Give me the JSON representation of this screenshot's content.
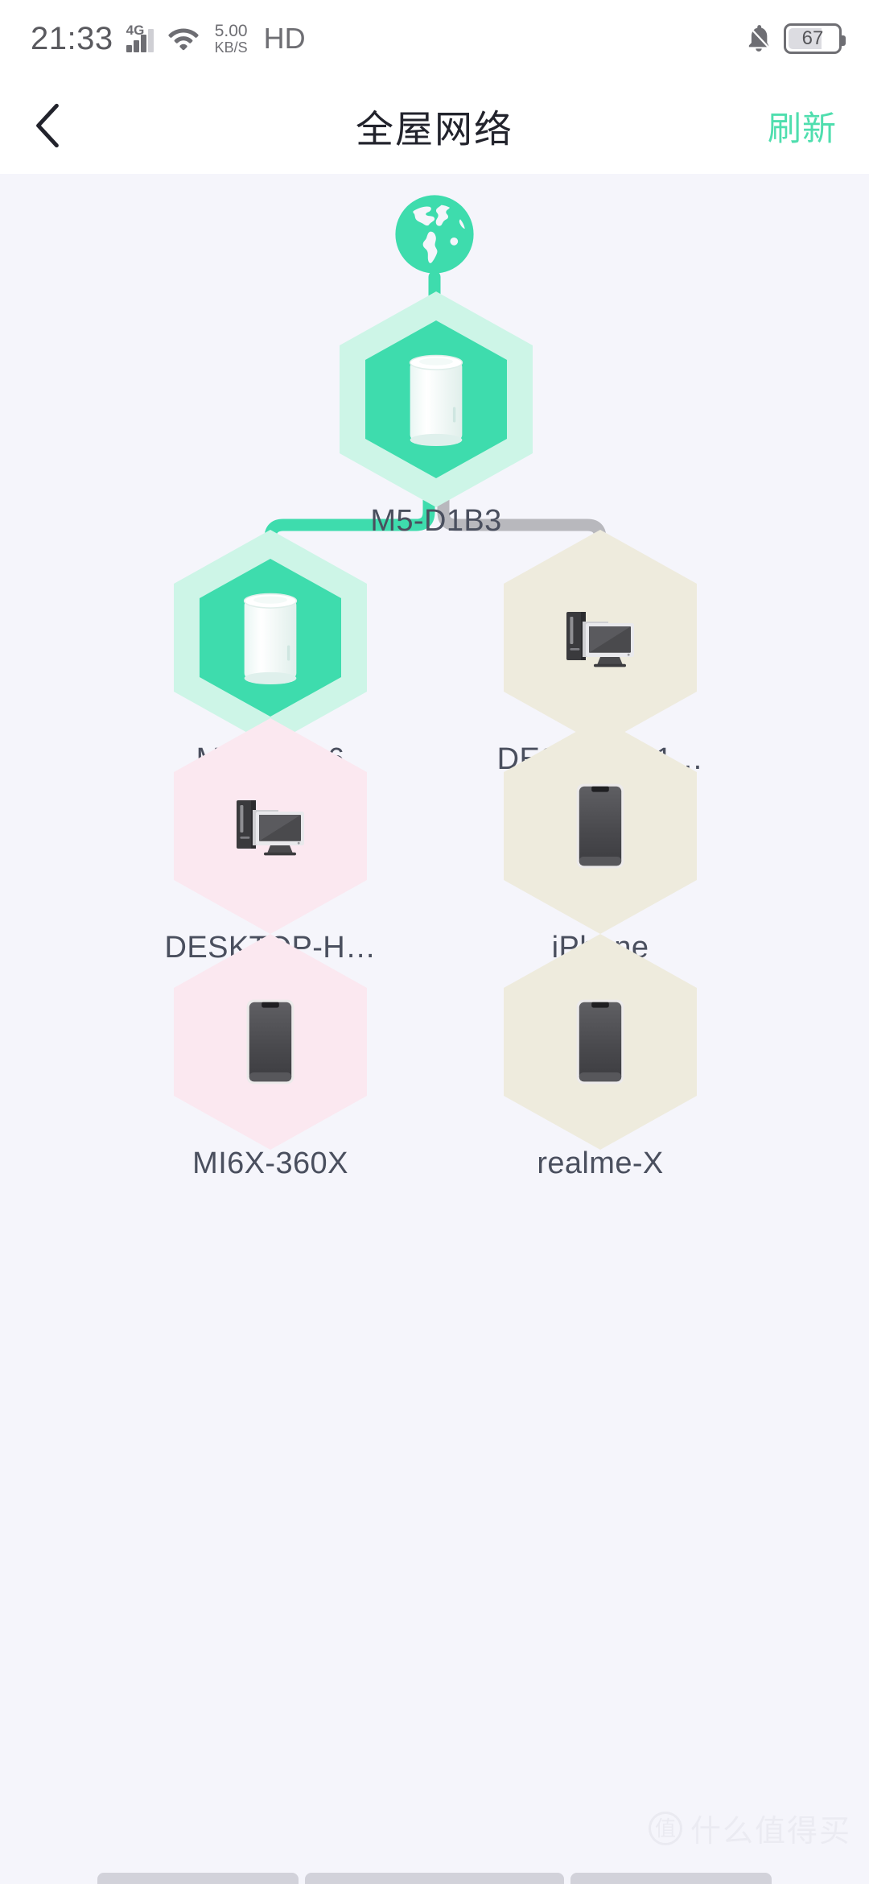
{
  "status_bar": {
    "time": "21:33",
    "network_type": "4G",
    "wifi_icon": "wifi-icon",
    "speed_value": "5.00",
    "speed_unit": "KB/S",
    "hd_label": "HD",
    "mute_icon": "bell-muted-icon",
    "battery_level": "67"
  },
  "header": {
    "back_icon": "chevron-left-icon",
    "title": "全屋网络",
    "refresh_label": "刷新"
  },
  "topology": {
    "internet": {
      "icon": "globe-icon",
      "label": ""
    },
    "nodes": [
      {
        "id": "m5-d1b3",
        "label": "M5-D1B3",
        "icon": "router-icon",
        "type": "router",
        "halo_color": "#cdf5e7",
        "core_color": "#3edcad"
      },
      {
        "id": "m50-d1b6",
        "label": "M50-D1B6",
        "icon": "router-icon",
        "type": "router",
        "halo_color": "#cdf5e7",
        "core_color": "#3edcad"
      },
      {
        "id": "desktop-1",
        "label": "DESKTOP-1…",
        "icon": "desktop-pc-icon",
        "type": "computer",
        "halo_color": "#eeebdd",
        "core_color": "#eeebdd"
      },
      {
        "id": "desktop-h",
        "label": "DESKTOP-H…",
        "icon": "desktop-pc-icon",
        "type": "computer",
        "halo_color": "#fbe8f0",
        "core_color": "#fbe8f0"
      },
      {
        "id": "iphone",
        "label": "iPhone",
        "icon": "smartphone-icon",
        "type": "phone",
        "halo_color": "#eeebdd",
        "core_color": "#eeebdd"
      },
      {
        "id": "mi6x-360x",
        "label": "MI6X-360X",
        "icon": "smartphone-icon",
        "type": "phone",
        "halo_color": "#fbe8f0",
        "core_color": "#fbe8f0"
      },
      {
        "id": "realme-x",
        "label": "realme-X",
        "icon": "smartphone-icon",
        "type": "phone",
        "halo_color": "#eeebdd",
        "core_color": "#eeebdd"
      }
    ],
    "link_colors": {
      "active": "#3edcad",
      "inactive": "#b8b8bd"
    }
  },
  "watermark": {
    "logo_glyph": "值",
    "text": "什么值得买"
  },
  "colors": {
    "accent": "#4fdeae",
    "page_background": "#f5f5fb",
    "bar_background": "#ffffff",
    "label_text": "#4a4f5e"
  }
}
